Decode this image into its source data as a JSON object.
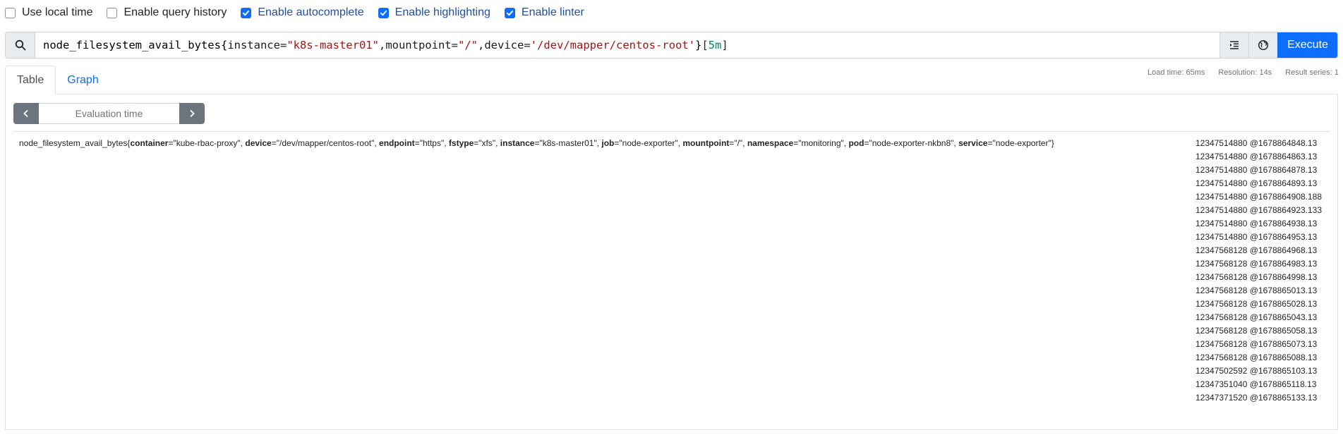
{
  "options": [
    {
      "label": "Use local time",
      "checked": false
    },
    {
      "label": "Enable query history",
      "checked": false
    },
    {
      "label": "Enable autocomplete",
      "checked": true
    },
    {
      "label": "Enable highlighting",
      "checked": true
    },
    {
      "label": "Enable linter",
      "checked": true
    }
  ],
  "query": {
    "metric": "node_filesystem_avail_bytes",
    "open_brace": "{",
    "label1": "instance",
    "eq1": "=",
    "val1": "\"k8s-master01\"",
    "comma1": ",",
    "label2": "mountpoint",
    "eq2": "=",
    "val2": "\"/\"",
    "comma2": ",",
    "label3": "device",
    "eq3": "=",
    "val3": "'/dev/mapper/centos-root'",
    "close_brace": "}",
    "range_open": "[",
    "range": "5m",
    "range_close": "]",
    "execute_label": "Execute"
  },
  "tabs": {
    "table": "Table",
    "graph": "Graph"
  },
  "stats": {
    "load_time": "Load time: 65ms",
    "resolution": "Resolution: 14s",
    "result_series": "Result series: 1"
  },
  "eval_time_placeholder": "Evaluation time",
  "series": {
    "metric": "node_filesystem_avail_bytes",
    "open": "{",
    "close": "}",
    "labels": [
      {
        "key": "container",
        "value": "\"kube-rbac-proxy\"",
        "sep": ", "
      },
      {
        "key": "device",
        "value": "\"/dev/mapper/centos-root\"",
        "sep": ", "
      },
      {
        "key": "endpoint",
        "value": "\"https\"",
        "sep": ", "
      },
      {
        "key": "fstype",
        "value": "\"xfs\"",
        "sep": ", "
      },
      {
        "key": "instance",
        "value": "\"k8s-master01\"",
        "sep": ", "
      },
      {
        "key": "job",
        "value": "\"node-exporter\"",
        "sep": ", "
      },
      {
        "key": "mountpoint",
        "value": "\"/\"",
        "sep": ", "
      },
      {
        "key": "namespace",
        "value": "\"monitoring\"",
        "sep": ", "
      },
      {
        "key": "pod",
        "value": "\"node-exporter-nkbn8\"",
        "sep": ", "
      },
      {
        "key": "service",
        "value": "\"node-exporter\"",
        "sep": ""
      }
    ]
  },
  "values": [
    "12347514880 @1678864848.13",
    "12347514880 @1678864863.13",
    "12347514880 @1678864878.13",
    "12347514880 @1678864893.13",
    "12347514880 @1678864908.188",
    "12347514880 @1678864923.133",
    "12347514880 @1678864938.13",
    "12347514880 @1678864953.13",
    "12347568128 @1678864968.13",
    "12347568128 @1678864983.13",
    "12347568128 @1678864998.13",
    "12347568128 @1678865013.13",
    "12347568128 @1678865028.13",
    "12347568128 @1678865043.13",
    "12347568128 @1678865058.13",
    "12347568128 @1678865073.13",
    "12347568128 @1678865088.13",
    "12347502592 @1678865103.13",
    "12347351040 @1678865118.13",
    "12347371520 @1678865133.13"
  ]
}
